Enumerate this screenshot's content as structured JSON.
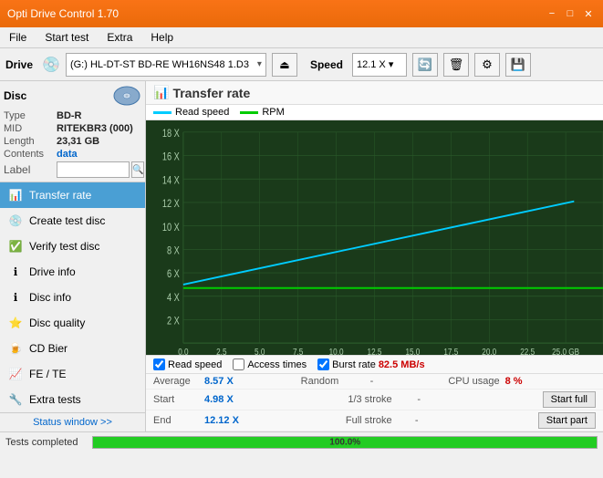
{
  "titleBar": {
    "title": "Opti Drive Control 1.70",
    "minimizeLabel": "−",
    "maximizeLabel": "□",
    "closeLabel": "✕"
  },
  "menuBar": {
    "items": [
      "File",
      "Start test",
      "Extra",
      "Help"
    ]
  },
  "driveBar": {
    "driveLabel": "Drive",
    "driveValue": "(G:) HL-DT-ST BD-RE  WH16NS48 1.D3",
    "speedLabel": "Speed",
    "speedValue": "12.1 X ▾"
  },
  "disc": {
    "title": "Disc",
    "typeLabel": "Type",
    "typeValue": "BD-R",
    "midLabel": "MID",
    "midValue": "RITEKBR3 (000)",
    "lengthLabel": "Length",
    "lengthValue": "23,31 GB",
    "contentsLabel": "Contents",
    "contentsValue": "data",
    "labelLabel": "Label",
    "labelValue": ""
  },
  "navItems": [
    {
      "id": "transfer-rate",
      "label": "Transfer rate",
      "active": true
    },
    {
      "id": "create-test-disc",
      "label": "Create test disc",
      "active": false
    },
    {
      "id": "verify-test-disc",
      "label": "Verify test disc",
      "active": false
    },
    {
      "id": "drive-info",
      "label": "Drive info",
      "active": false
    },
    {
      "id": "disc-info",
      "label": "Disc info",
      "active": false
    },
    {
      "id": "disc-quality",
      "label": "Disc quality",
      "active": false
    },
    {
      "id": "cd-bier",
      "label": "CD Bier",
      "active": false
    },
    {
      "id": "fe-te",
      "label": "FE / TE",
      "active": false
    },
    {
      "id": "extra-tests",
      "label": "Extra tests",
      "active": false
    }
  ],
  "statusWindowBtn": "Status window >>",
  "chart": {
    "title": "Transfer rate",
    "legendItems": [
      {
        "label": "Read speed",
        "color": "#00ccff"
      },
      {
        "label": "RPM",
        "color": "#00cc00"
      }
    ],
    "yAxisLabels": [
      "18 X",
      "16 X",
      "14 X",
      "12 X",
      "10 X",
      "8 X",
      "6 X",
      "4 X",
      "2 X"
    ],
    "xAxisLabels": [
      "0.0",
      "2.5",
      "5.0",
      "7.5",
      "10.0",
      "12.5",
      "15.0",
      "17.5",
      "20.0",
      "22.5",
      "25.0 GB"
    ]
  },
  "chartControls": {
    "readSpeedChecked": true,
    "readSpeedLabel": "Read speed",
    "accessTimesChecked": false,
    "accessTimesLabel": "Access times",
    "burstRateChecked": true,
    "burstRateLabel": "Burst rate",
    "burstRateValue": "82.5 MB/s"
  },
  "stats": {
    "row1": {
      "averageLabel": "Average",
      "averageValue": "8.57 X",
      "randomLabel": "Random",
      "randomValue": "-",
      "cpuLabel": "CPU usage",
      "cpuValue": "8 %"
    },
    "row2": {
      "startLabel": "Start",
      "startValue": "4.98 X",
      "strokeLabel": "1/3 stroke",
      "strokeValue": "-",
      "startFullLabel": "Start full"
    },
    "row3": {
      "endLabel": "End",
      "endValue": "12.12 X",
      "fullStrokeLabel": "Full stroke",
      "fullStrokeValue": "-",
      "startPartLabel": "Start part"
    }
  },
  "statusBar": {
    "text": "Tests completed",
    "progressPercent": 100,
    "progressLabel": "100.0%"
  }
}
